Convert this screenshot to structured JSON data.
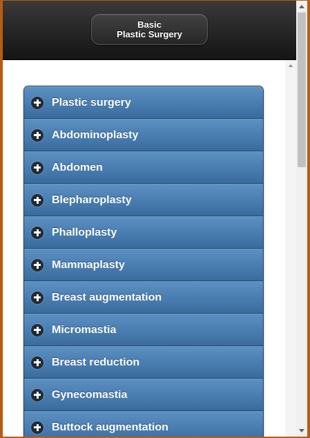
{
  "header": {
    "title_line1": "Basic",
    "title_line2": "Plastic Surgery"
  },
  "list": {
    "items": [
      {
        "label": "Plastic surgery",
        "icon": "plus-circle-icon"
      },
      {
        "label": "Abdominoplasty",
        "icon": "plus-circle-icon"
      },
      {
        "label": "Abdomen",
        "icon": "plus-circle-icon"
      },
      {
        "label": "Blepharoplasty",
        "icon": "plus-circle-icon"
      },
      {
        "label": "Phalloplasty",
        "icon": "plus-circle-icon"
      },
      {
        "label": "Mammaplasty",
        "icon": "plus-circle-icon"
      },
      {
        "label": "Breast augmentation",
        "icon": "plus-circle-icon"
      },
      {
        "label": "Micromastia",
        "icon": "plus-circle-icon"
      },
      {
        "label": "Breast reduction",
        "icon": "plus-circle-icon"
      },
      {
        "label": "Gynecomastia",
        "icon": "plus-circle-icon"
      },
      {
        "label": "Buttock augmentation",
        "icon": "plus-circle-icon"
      }
    ]
  },
  "colors": {
    "header_bg": "#1f1f1f",
    "item_bg": "#4a7eb2",
    "frame_border": "#b85c14"
  }
}
